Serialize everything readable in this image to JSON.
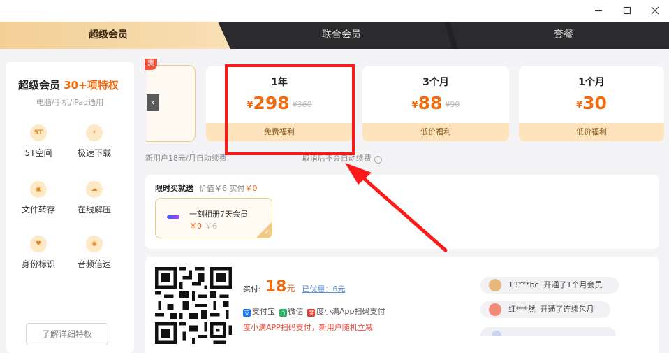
{
  "window": {
    "minimize": "minimize",
    "maximize": "maximize",
    "close": "close"
  },
  "tabs": [
    "超级会员",
    "联合会员",
    "套餐"
  ],
  "sidebar": {
    "title": "超级会员",
    "title_highlight": "30+项特权",
    "subtitle": "电脑/手机/iPad通用",
    "features": [
      {
        "icon": "5T",
        "label": "5T空间"
      },
      {
        "icon": "bolt",
        "label": "极速下载"
      },
      {
        "icon": "folder",
        "label": "文件转存"
      },
      {
        "icon": "cloud",
        "label": "在线解压"
      },
      {
        "icon": "badge",
        "label": "身份标识"
      },
      {
        "icon": "speed",
        "label": "音频倍速"
      }
    ],
    "more_button": "了解详细特权"
  },
  "hidden_card_badge": "惠",
  "plans": [
    {
      "name": "1年",
      "currency": "¥",
      "price": "298",
      "original": "¥360",
      "tag": "免费福利"
    },
    {
      "name": "3个月",
      "currency": "¥",
      "price": "88",
      "original": "¥90",
      "tag": "低价福利"
    },
    {
      "name": "1个月",
      "currency": "¥",
      "price": "30",
      "original": "",
      "tag": "低价福利"
    }
  ],
  "notice": {
    "left": "新用户18元/月自动续费",
    "right": "取消后不会自动续费"
  },
  "promo": {
    "title": "限时买就送",
    "value_text": "价值￥6 实付",
    "paid": "￥0",
    "gift_name": "一刻相册7天会员",
    "gift_price": "￥0",
    "gift_original": "￥6"
  },
  "payment": {
    "label": "实付:",
    "amount": "18",
    "unit": "元",
    "discount": "已优惠：6元",
    "alipay": "支付宝",
    "wechat": "微信",
    "duxiaoman": "度小满App扫码支付",
    "promo": "度小满APP扫码支付，新用户随机立减"
  },
  "feed": [
    {
      "user": "13***bc",
      "action": "开通了1个月会员"
    },
    {
      "user": "红***然",
      "action": "开通了连续包月"
    }
  ],
  "colors": {
    "accent": "#f06a0f",
    "gold": "#f2cf95",
    "highlight_box": "#ff1a1a",
    "arrow": "#ff1a1a"
  }
}
